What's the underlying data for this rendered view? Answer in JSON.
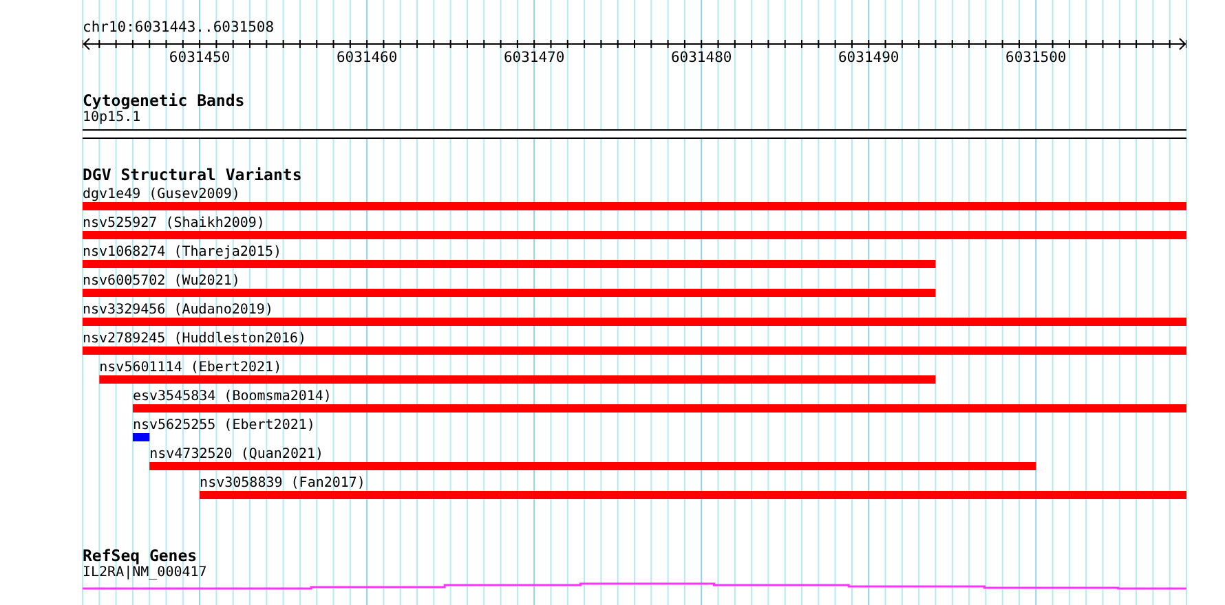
{
  "location": "chr10:6031443..6031508",
  "ruler": {
    "labels": [
      "6031450",
      "6031460",
      "6031470",
      "6031480",
      "6031490",
      "6031500"
    ]
  },
  "tracks": [
    {
      "kind": "bands",
      "title": "Cytogenetic Bands",
      "label": "10p15.1"
    },
    {
      "kind": "variants",
      "title": "DGV Structural Variants",
      "features": [
        {
          "label": "dgv1e49 (Gusev2009)",
          "color": "#ff0000"
        },
        {
          "label": "nsv525927 (Shaikh2009)",
          "color": "#ff0000"
        },
        {
          "label": "nsv1068274 (Thareja2015)",
          "color": "#ff0000"
        },
        {
          "label": "nsv6005702 (Wu2021)",
          "color": "#ff0000"
        },
        {
          "label": "nsv3329456 (Audano2019)",
          "color": "#ff0000"
        },
        {
          "label": "nsv2789245 (Huddleston2016)",
          "color": "#ff0000"
        },
        {
          "label": "nsv5601114 (Ebert2021)",
          "color": "#ff0000"
        },
        {
          "label": "esv3545834 (Boomsma2014)",
          "color": "#ff0000"
        },
        {
          "label": "nsv5625255 (Ebert2021)",
          "color": "#0000ff"
        },
        {
          "label": "nsv4732520 (Quan2021)",
          "color": "#ff0000"
        },
        {
          "label": "nsv3058839 (Fan2017)",
          "color": "#ff0000"
        }
      ]
    },
    {
      "kind": "genes",
      "title": "RefSeq Genes",
      "label": "IL2RA|NM_000417"
    }
  ]
}
